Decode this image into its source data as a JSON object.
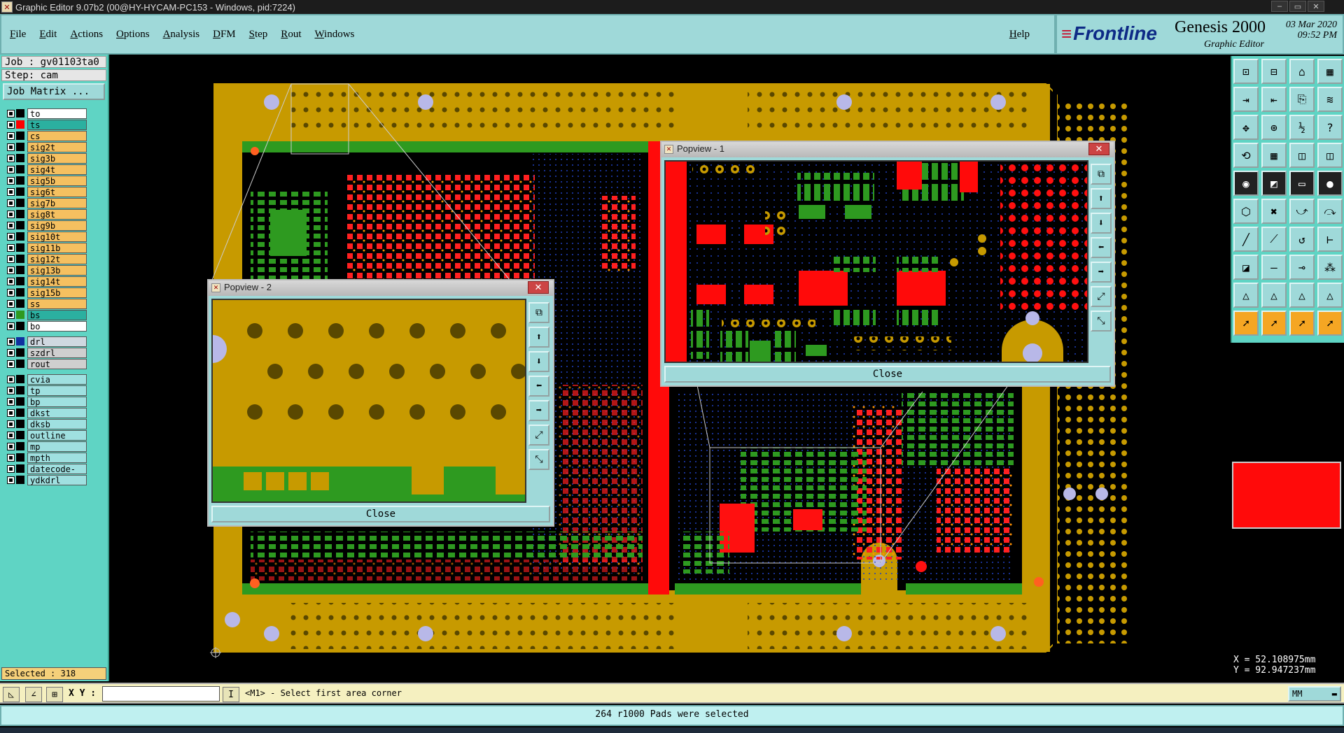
{
  "window": {
    "title": "Graphic Editor 9.07b2 (00@HY-HYCAM-PC153 - Windows, pid:7224)",
    "min": "–",
    "max": "▭",
    "close": "✕"
  },
  "menu": {
    "items": [
      "File",
      "Edit",
      "Actions",
      "Options",
      "Analysis",
      "DFM",
      "Step",
      "Rout",
      "Windows"
    ],
    "help": "Help"
  },
  "brand": {
    "logo": "Frontline",
    "product": "Genesis 2000",
    "subtitle": "Graphic Editor",
    "date": "03 Mar 2020",
    "time": "09:52 PM"
  },
  "left": {
    "job": "Job : gv01103ta0",
    "step": "Step: cam",
    "job_matrix": "Job Matrix ...",
    "layers_group1": [
      {
        "name": "to",
        "color": "#ffffff",
        "swatch": "#000000"
      },
      {
        "name": "ts",
        "color": "#2bb0a0",
        "swatch": "#ff0000"
      },
      {
        "name": "cs",
        "color": "#f5c060",
        "swatch": "#000000"
      },
      {
        "name": "sig2t",
        "color": "#f5c060",
        "swatch": "#000000"
      },
      {
        "name": "sig3b",
        "color": "#f5c060",
        "swatch": "#000000"
      },
      {
        "name": "sig4t",
        "color": "#f5c060",
        "swatch": "#000000"
      },
      {
        "name": "sig5b",
        "color": "#f5c060",
        "swatch": "#000000"
      },
      {
        "name": "sig6t",
        "color": "#f5c060",
        "swatch": "#000000"
      },
      {
        "name": "sig7b",
        "color": "#f5c060",
        "swatch": "#000000"
      },
      {
        "name": "sig8t",
        "color": "#f5c060",
        "swatch": "#000000"
      },
      {
        "name": "sig9b",
        "color": "#f5c060",
        "swatch": "#000000"
      },
      {
        "name": "sig10t",
        "color": "#f5c060",
        "swatch": "#000000"
      },
      {
        "name": "sig11b",
        "color": "#f5c060",
        "swatch": "#000000"
      },
      {
        "name": "sig12t",
        "color": "#f5c060",
        "swatch": "#000000"
      },
      {
        "name": "sig13b",
        "color": "#f5c060",
        "swatch": "#000000"
      },
      {
        "name": "sig14t",
        "color": "#f5c060",
        "swatch": "#000000"
      },
      {
        "name": "sig15b",
        "color": "#f5c060",
        "swatch": "#000000"
      },
      {
        "name": "ss",
        "color": "#f5c060",
        "swatch": "#000000"
      },
      {
        "name": "bs",
        "color": "#2bb0a0",
        "swatch": "#2e9a20"
      },
      {
        "name": "bo",
        "color": "#ffffff",
        "swatch": "#000000"
      }
    ],
    "layers_group2": [
      {
        "name": "drl",
        "color": "#cfd8e0",
        "swatch": "#1030a0"
      },
      {
        "name": "szdrl",
        "color": "#cfcfcf",
        "swatch": "#000000"
      },
      {
        "name": "rout",
        "color": "#cfcfcf",
        "swatch": "#000000"
      }
    ],
    "layers_group3": [
      {
        "name": "cvia",
        "color": "#9fe0e0",
        "swatch": "#000000"
      },
      {
        "name": "tp",
        "color": "#9fe0e0",
        "swatch": "#000000"
      },
      {
        "name": "bp",
        "color": "#9fe0e0",
        "swatch": "#000000"
      },
      {
        "name": "dkst",
        "color": "#9fe0e0",
        "swatch": "#000000"
      },
      {
        "name": "dksb",
        "color": "#9fe0e0",
        "swatch": "#000000"
      },
      {
        "name": "outline",
        "color": "#9fe0e0",
        "swatch": "#000000"
      },
      {
        "name": "mp",
        "color": "#9fe0e0",
        "swatch": "#000000"
      },
      {
        "name": "mpth",
        "color": "#9fe0e0",
        "swatch": "#000000"
      },
      {
        "name": "datecode-pbe",
        "color": "#9fe0e0",
        "swatch": "#000000"
      },
      {
        "name": "ydkdrl",
        "color": "#9fe0e0",
        "swatch": "#000000"
      }
    ],
    "selected": "Selected : 318"
  },
  "popview1": {
    "title": "Popview - 1",
    "close": "Close"
  },
  "popview2": {
    "title": "Popview - 2",
    "close": "Close"
  },
  "coords": {
    "x": "X = 52.108975mm",
    "y": "Y = 92.947237mm"
  },
  "cmd": {
    "xy_label": "X Y :",
    "xy_value": "",
    "prompt": "<M1> - Select first area corner",
    "unit": "MM"
  },
  "status": "264 r1000 Pads were selected",
  "colors": {
    "board": "#c79a00",
    "green": "#2e9a20",
    "red": "#ff0000",
    "via": "#b8b8e8",
    "panel": "#9fd9d9"
  }
}
